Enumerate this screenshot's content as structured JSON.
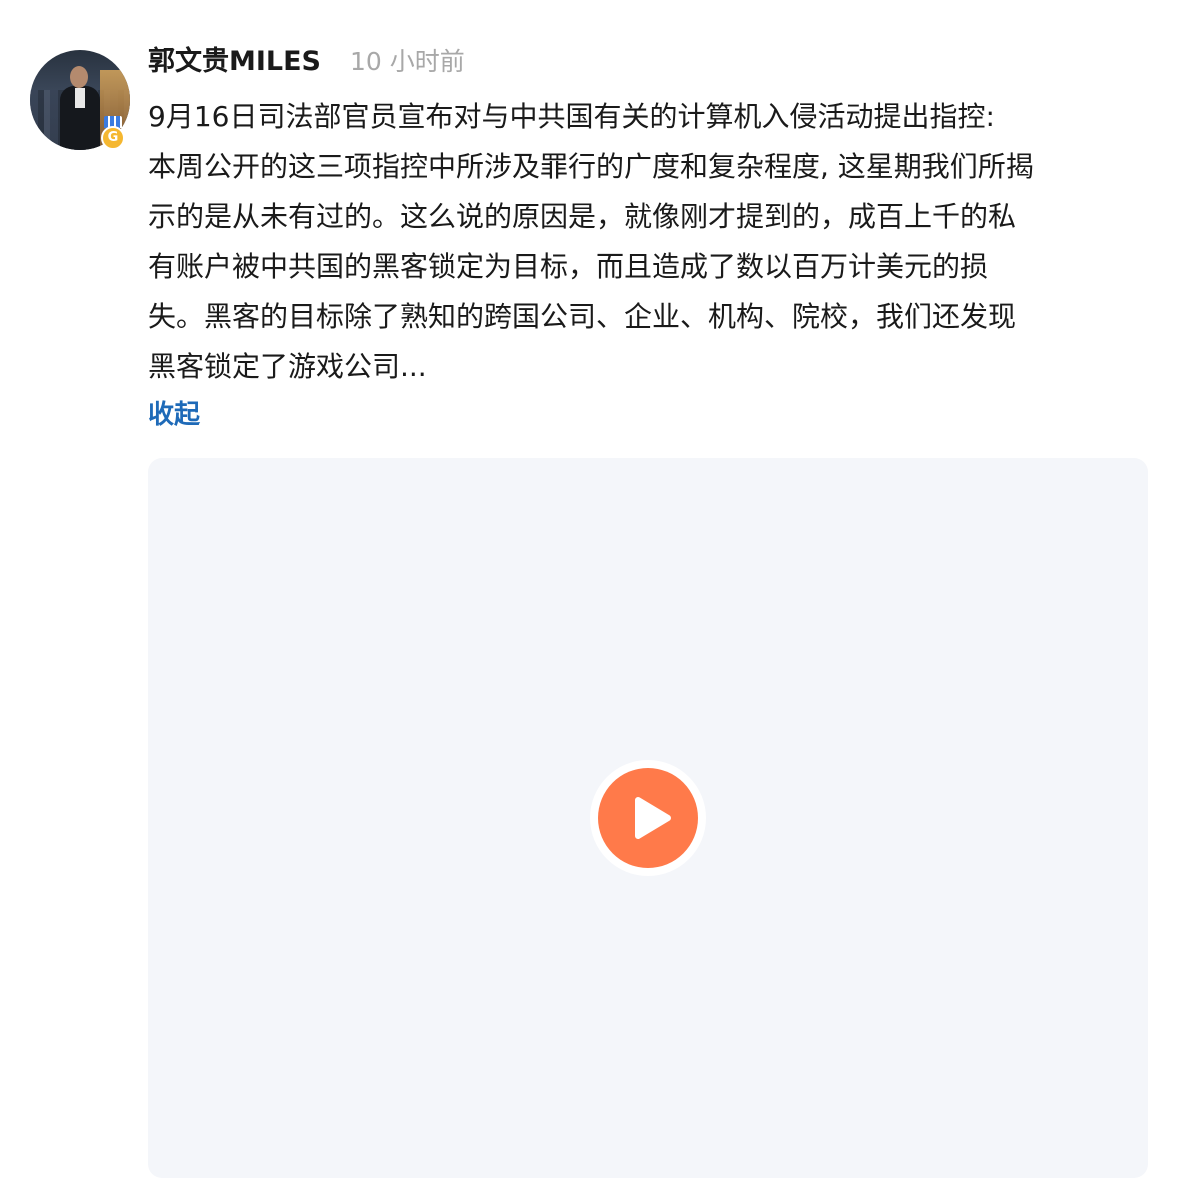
{
  "post": {
    "username": "郭文贵MILES",
    "timestamp": "10 小时前",
    "badge_letter": "G",
    "content_lines": [
      "9月16日司法部官员宣布对与中共国有关的计算机入侵活动提出指控:",
      "本周公开的这三项指控中所涉及罪行的广度和复杂程度, 这星期我们所揭",
      "示的是从未有过的。这么说的原因是，就像刚才提到的，成百上千的私",
      "有账户被中共国的黑客锁定为目标，而且造成了数以百万计美元的损",
      "失。黑客的目标除了熟知的跨国公司、企业、机构、院校，我们还发现",
      "黑客锁定了游戏公司..."
    ],
    "collapse_label": "收起"
  },
  "video": {
    "play_icon": "play-icon"
  },
  "colors": {
    "accent_link": "#1e6ab8",
    "play_button": "#ff7a4a",
    "video_placeholder": "#f4f6fa",
    "timestamp_gray": "#a8a8a8"
  }
}
